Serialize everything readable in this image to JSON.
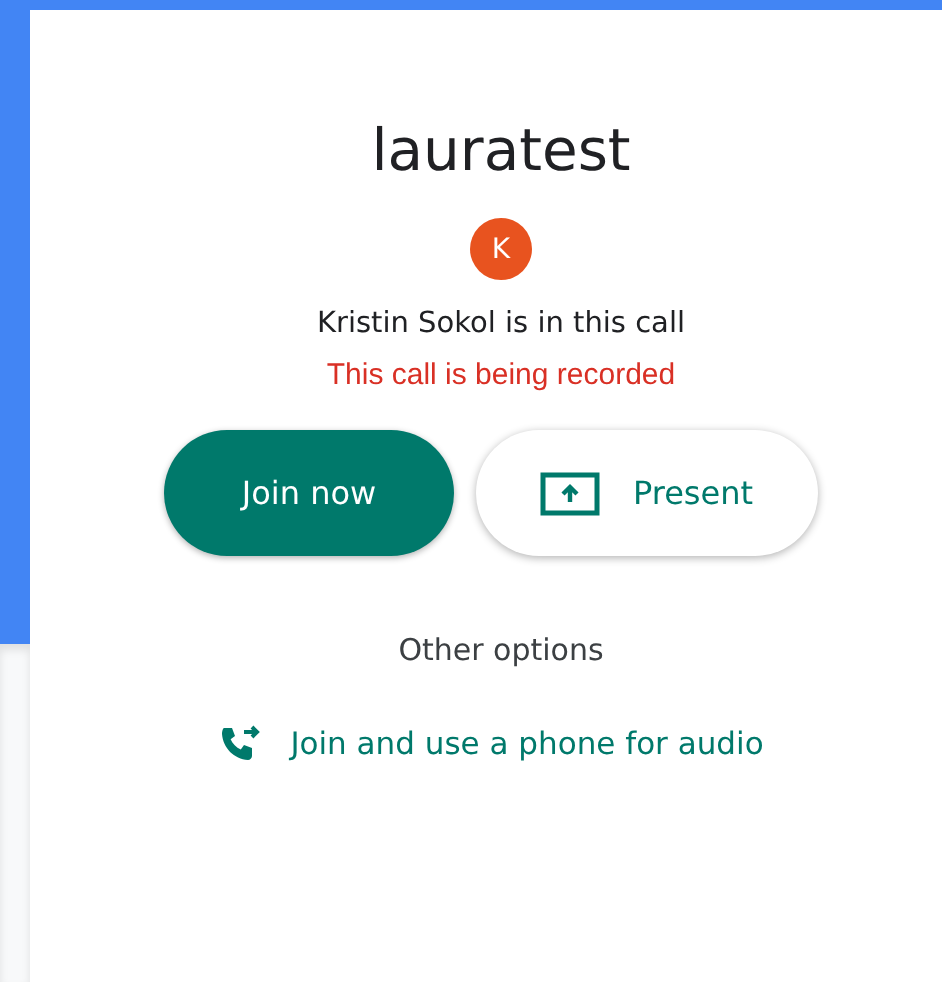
{
  "meeting": {
    "title": "lauratest"
  },
  "participant": {
    "initial": "K",
    "color": "#e8531f",
    "status": "Kristin Sokol is in this call"
  },
  "recording_notice": "This call is being recorded",
  "buttons": [
    {
      "kind": "primary",
      "label": "Join now"
    },
    {
      "kind": "present",
      "label": "Present"
    }
  ],
  "other_options": {
    "heading": "Other options",
    "phone_link": "Join and use a phone for audio"
  }
}
